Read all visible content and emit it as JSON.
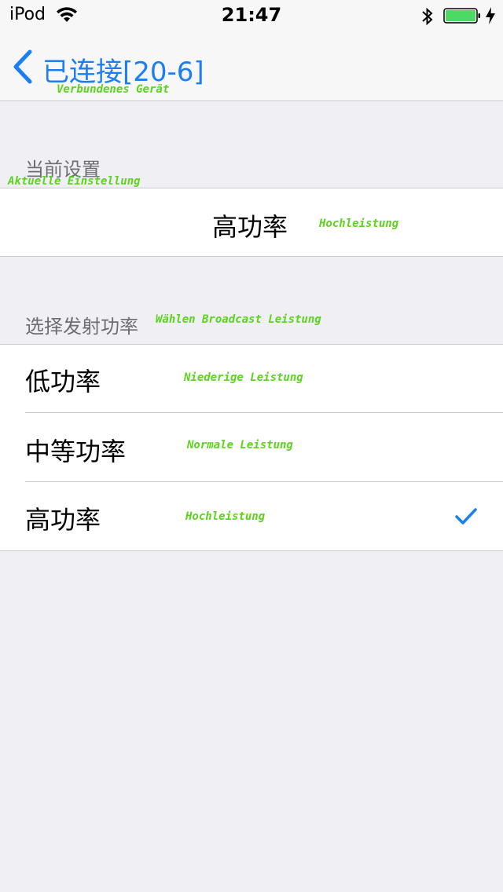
{
  "status_bar": {
    "carrier": "iPod",
    "time": "21:47",
    "battery_color": "#4cd964"
  },
  "nav": {
    "back_title": "已连接[20-6]",
    "back_subtitle": "Verbundenes Gerät",
    "accent_color": "#1a7ef5"
  },
  "current_setting": {
    "header": "当前设置",
    "header_note": "Aktuelle Einstellung",
    "value": "高功率",
    "value_note": "Hochleistung"
  },
  "power_select": {
    "header": "选择发射功率",
    "header_note": "Wählen Broadcast Leistung",
    "options": [
      {
        "label": "低功率",
        "note": "Niederige Leistung",
        "selected": false
      },
      {
        "label": "中等功率",
        "note": "Normale Leistung",
        "selected": false
      },
      {
        "label": "高功率",
        "note": "Hochleistung",
        "selected": true
      }
    ]
  },
  "icons": {
    "back": "chevron-left-icon",
    "wifi": "wifi-icon",
    "bluetooth": "bluetooth-icon",
    "battery": "battery-icon",
    "charging": "charging-bolt-icon",
    "selected": "checkmark-icon"
  }
}
